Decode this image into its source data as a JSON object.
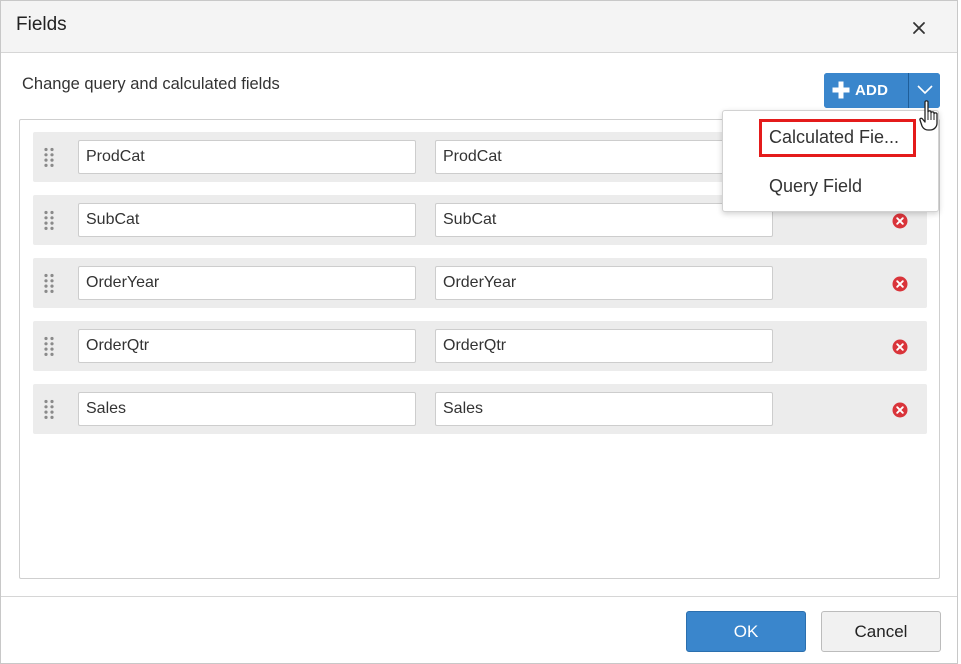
{
  "dialog": {
    "title": "Fields",
    "subheading": "Change query and calculated fields"
  },
  "toolbar": {
    "add_label": "ADD"
  },
  "add_menu": {
    "items": [
      "Calculated Fie...",
      "Query Field"
    ]
  },
  "fields": [
    {
      "name": "ProdCat",
      "expression": "ProdCat"
    },
    {
      "name": "SubCat",
      "expression": "SubCat"
    },
    {
      "name": "OrderYear",
      "expression": "OrderYear"
    },
    {
      "name": "OrderQtr",
      "expression": "OrderQtr"
    },
    {
      "name": "Sales",
      "expression": "Sales"
    }
  ],
  "footer": {
    "ok_label": "OK",
    "cancel_label": "Cancel"
  },
  "colors": {
    "accent": "#3a86cc",
    "delete": "#d9343a",
    "highlight": "#e41b1b"
  }
}
